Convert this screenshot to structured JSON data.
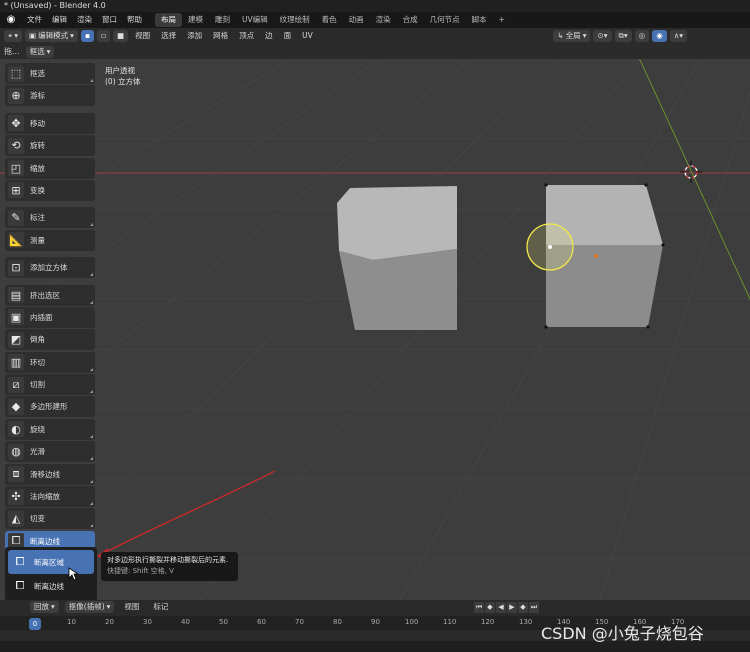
{
  "window": {
    "title": "* (Unsaved) - Blender 4.0"
  },
  "menu": {
    "items": [
      "文件",
      "编辑",
      "渲染",
      "窗口",
      "帮助"
    ],
    "workspaces": [
      "布局",
      "建模",
      "雕刻",
      "UV编辑",
      "纹理绘制",
      "着色",
      "动画",
      "渲染",
      "合成",
      "几何节点",
      "脚本"
    ],
    "add": "+"
  },
  "header": {
    "mode": "编辑模式",
    "menus": [
      "视图",
      "选择",
      "添加",
      "网格",
      "顶点",
      "边",
      "面",
      "UV"
    ],
    "orientation": "全局"
  },
  "subheader": {
    "left": "拖...",
    "select": "框选"
  },
  "viewport": {
    "line1": "用户透视",
    "line2": "(0) 立方体"
  },
  "tools": [
    {
      "label": "框选",
      "icon": "select-box-icon"
    },
    {
      "label": "游标",
      "icon": "cursor-icon"
    },
    {
      "label": "移动",
      "icon": "move-icon"
    },
    {
      "label": "旋转",
      "icon": "rotate-icon"
    },
    {
      "label": "缩放",
      "icon": "scale-icon"
    },
    {
      "label": "变换",
      "icon": "transform-icon"
    },
    {
      "label": "标注",
      "icon": "annotate-icon"
    },
    {
      "label": "测量",
      "icon": "measure-icon"
    },
    {
      "label": "添加立方体",
      "icon": "add-cube-icon"
    },
    {
      "label": "挤出选区",
      "icon": "extrude-icon"
    },
    {
      "label": "内插面",
      "icon": "inset-icon"
    },
    {
      "label": "倒角",
      "icon": "bevel-icon"
    },
    {
      "label": "环切",
      "icon": "loop-cut-icon"
    },
    {
      "label": "切割",
      "icon": "knife-icon"
    },
    {
      "label": "多边形建形",
      "icon": "poly-build-icon"
    },
    {
      "label": "旋绕",
      "icon": "spin-icon"
    },
    {
      "label": "光滑",
      "icon": "smooth-icon"
    },
    {
      "label": "滑移边线",
      "icon": "edge-slide-icon"
    },
    {
      "label": "法向缩放",
      "icon": "shrink-fatten-icon"
    },
    {
      "label": "切变",
      "icon": "shear-icon"
    },
    {
      "label": "断离边线",
      "icon": "rip-edge-icon"
    }
  ],
  "flyout": {
    "item1": "断离区域",
    "item2": "断离边线"
  },
  "tooltip": {
    "line1": "对多边形执行撕裂并移动撕裂后的元素.",
    "line2": "快捷键: Shift 空格, V"
  },
  "timeline": {
    "menus": [
      "回放",
      "抠像(插帧)",
      "视图",
      "标记"
    ],
    "current_frame": "0",
    "ticks": [
      "10",
      "20",
      "30",
      "40",
      "50",
      "60",
      "70",
      "80",
      "90",
      "100",
      "110",
      "120",
      "130",
      "140",
      "150",
      "160",
      "170"
    ]
  },
  "watermark": "CSDN @小兔子烧包谷"
}
